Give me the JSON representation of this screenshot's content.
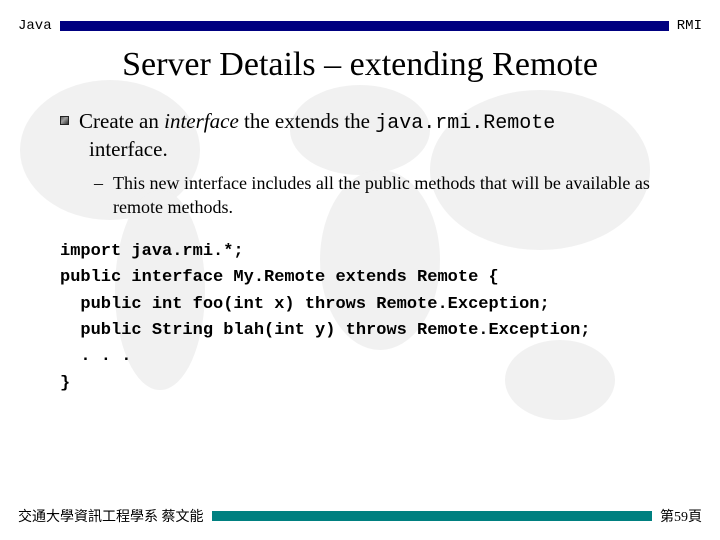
{
  "header": {
    "left": "Java",
    "right": "RMI"
  },
  "title": "Server Details – extending Remote",
  "bullet": {
    "pre": "Create an ",
    "italic": "interface",
    "mid": " the extends the ",
    "mono": "java.rmi.Remote",
    "post_line2": "interface."
  },
  "sub": {
    "dash": "–",
    "text": "This new interface includes all the public methods that will be available as remote methods."
  },
  "code": "import java.rmi.*;\npublic interface My.Remote extends Remote {\n  public int foo(int x) throws Remote.Exception;\n  public String blah(int y) throws Remote.Exception;\n  . . .\n}",
  "footer": {
    "left": "交通大學資訊工程學系 蔡文能",
    "right": "第59頁"
  }
}
